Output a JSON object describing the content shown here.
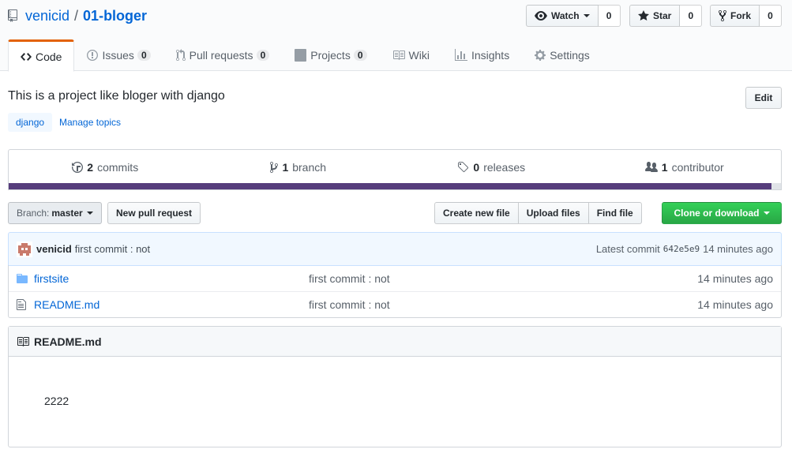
{
  "repo": {
    "owner": "venicid",
    "separator": "/",
    "name": "01-bloger"
  },
  "actions": {
    "watch": {
      "label": "Watch",
      "count": "0",
      "icon": "eye-icon"
    },
    "star": {
      "label": "Star",
      "count": "0",
      "icon": "star-icon"
    },
    "fork": {
      "label": "Fork",
      "count": "0",
      "icon": "fork-icon"
    }
  },
  "nav": [
    {
      "label": "Code",
      "icon": "code-icon",
      "selected": true
    },
    {
      "label": "Issues",
      "count": "0",
      "icon": "issue-icon"
    },
    {
      "label": "Pull requests",
      "count": "0",
      "icon": "pull-request-icon"
    },
    {
      "label": "Projects",
      "count": "0",
      "icon": "project-icon"
    },
    {
      "label": "Wiki",
      "icon": "book-icon"
    },
    {
      "label": "Insights",
      "icon": "graph-icon"
    },
    {
      "label": "Settings",
      "icon": "gear-icon"
    }
  ],
  "about": {
    "description": "This is a project like bloger with django",
    "edit_label": "Edit",
    "topic": "django",
    "manage_topics": "Manage topics"
  },
  "summary": {
    "commits": {
      "num": "2",
      "label": "commits"
    },
    "branches": {
      "num": "1",
      "label": "branch"
    },
    "releases": {
      "num": "0",
      "label": "releases"
    },
    "contributors": {
      "num": "1",
      "label": "contributor"
    },
    "language_bar": {
      "color": "#563d7c",
      "percent": 98.8
    }
  },
  "toolbar": {
    "branch_label": "Branch:",
    "branch_name": "master",
    "new_pr": "New pull request",
    "create_file": "Create new file",
    "upload_files": "Upload files",
    "find_file": "Find file",
    "clone": "Clone or download"
  },
  "commit": {
    "author": "venicid",
    "message": "first commit : not",
    "latest_label": "Latest commit",
    "sha": "642e5e9",
    "age": "14 minutes ago"
  },
  "files": [
    {
      "name": "firstsite",
      "type": "folder",
      "message": "first commit : not",
      "age": "14 minutes ago"
    },
    {
      "name": "README.md",
      "type": "file",
      "message": "first commit : not",
      "age": "14 minutes ago"
    }
  ],
  "readme": {
    "title": "README.md",
    "content": "2222"
  },
  "colors": {
    "link": "#0366d6",
    "accent_tab": "#e36209",
    "primary_btn": "#28a745"
  }
}
